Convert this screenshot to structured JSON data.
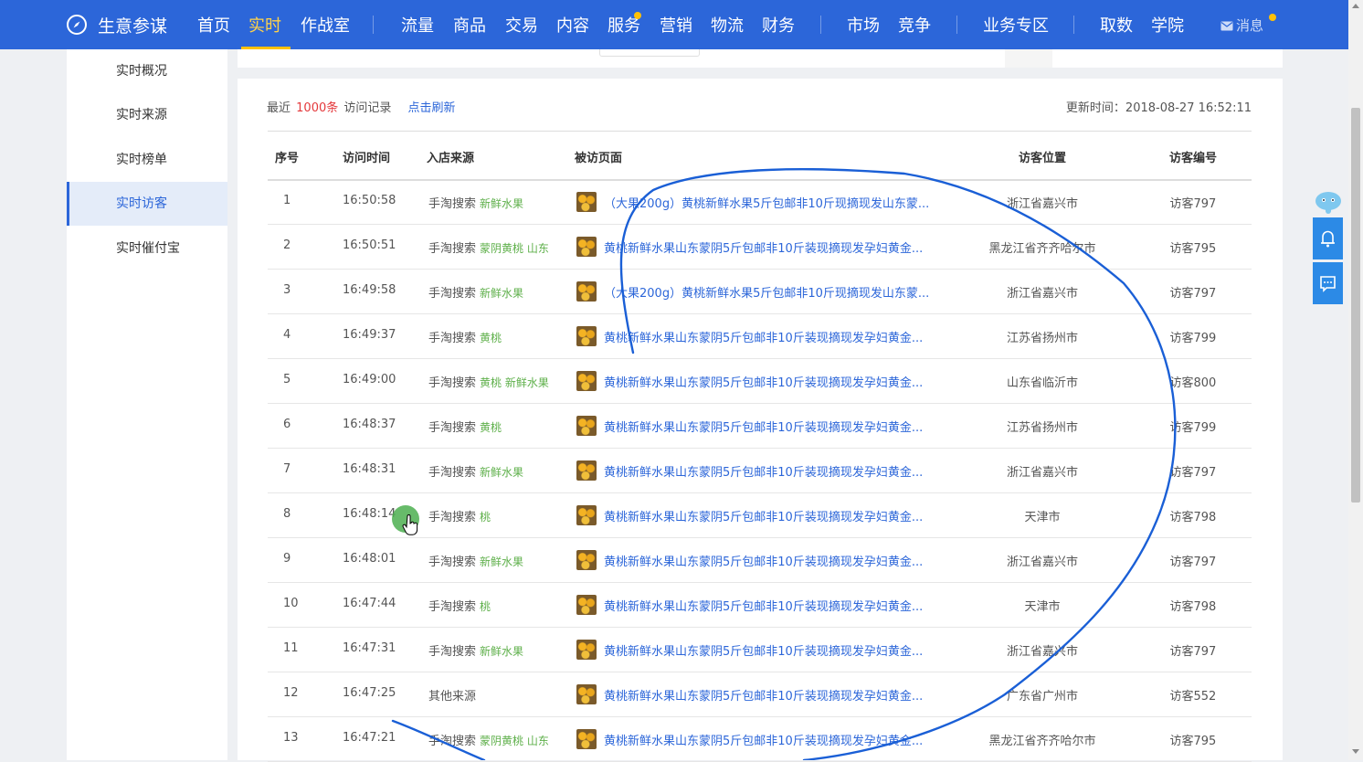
{
  "nav": {
    "brand": "生意参谋",
    "items": [
      "首页",
      "实时",
      "作战室",
      "流量",
      "商品",
      "交易",
      "内容",
      "服务",
      "营销",
      "物流",
      "财务",
      "市场",
      "竞争",
      "业务专区",
      "取数",
      "学院"
    ],
    "active": "实时",
    "message": "消息"
  },
  "sidebar": {
    "items": [
      "实时概况",
      "实时来源",
      "实时榜单",
      "实时访客",
      "实时催付宝"
    ],
    "active": "实时访客"
  },
  "header": {
    "prefix": "最近",
    "count": "1000条",
    "suffix": "访问记录",
    "refresh": "点击刷新",
    "updated": "更新时间：2018-08-27 16:52:11"
  },
  "table": {
    "columns": [
      "序号",
      "访问时间",
      "入店来源",
      "被访页面",
      "访客位置",
      "访客编号"
    ],
    "rows": [
      {
        "no": "1",
        "time": "16:50:58",
        "src": "手淘搜索",
        "kw": "新鲜水果",
        "page": "（大果200g）黄桃新鲜水果5斤包邮非10斤现摘现发山东蒙...",
        "loc": "浙江省嘉兴市",
        "vid": "访客797"
      },
      {
        "no": "2",
        "time": "16:50:51",
        "src": "手淘搜索",
        "kw": "蒙阴黄桃 山东",
        "page": "黄桃新鲜水果山东蒙阴5斤包邮非10斤装现摘现发孕妇黄金...",
        "loc": "黑龙江省齐齐哈尔市",
        "vid": "访客795"
      },
      {
        "no": "3",
        "time": "16:49:58",
        "src": "手淘搜索",
        "kw": "新鲜水果",
        "page": "（大果200g）黄桃新鲜水果5斤包邮非10斤现摘现发山东蒙...",
        "loc": "浙江省嘉兴市",
        "vid": "访客797"
      },
      {
        "no": "4",
        "time": "16:49:37",
        "src": "手淘搜索",
        "kw": "黄桃",
        "page": "黄桃新鲜水果山东蒙阴5斤包邮非10斤装现摘现发孕妇黄金...",
        "loc": "江苏省扬州市",
        "vid": "访客799"
      },
      {
        "no": "5",
        "time": "16:49:00",
        "src": "手淘搜索",
        "kw": "黄桃 新鲜水果",
        "page": "黄桃新鲜水果山东蒙阴5斤包邮非10斤装现摘现发孕妇黄金...",
        "loc": "山东省临沂市",
        "vid": "访客800"
      },
      {
        "no": "6",
        "time": "16:48:37",
        "src": "手淘搜索",
        "kw": "黄桃",
        "page": "黄桃新鲜水果山东蒙阴5斤包邮非10斤装现摘现发孕妇黄金...",
        "loc": "江苏省扬州市",
        "vid": "访客799"
      },
      {
        "no": "7",
        "time": "16:48:31",
        "src": "手淘搜索",
        "kw": "新鲜水果",
        "page": "黄桃新鲜水果山东蒙阴5斤包邮非10斤装现摘现发孕妇黄金...",
        "loc": "浙江省嘉兴市",
        "vid": "访客797"
      },
      {
        "no": "8",
        "time": "16:48:14",
        "src": "手淘搜索",
        "kw": "桃",
        "page": "黄桃新鲜水果山东蒙阴5斤包邮非10斤装现摘现发孕妇黄金...",
        "loc": "天津市",
        "vid": "访客798"
      },
      {
        "no": "9",
        "time": "16:48:01",
        "src": "手淘搜索",
        "kw": "新鲜水果",
        "page": "黄桃新鲜水果山东蒙阴5斤包邮非10斤装现摘现发孕妇黄金...",
        "loc": "浙江省嘉兴市",
        "vid": "访客797"
      },
      {
        "no": "10",
        "time": "16:47:44",
        "src": "手淘搜索",
        "kw": "桃",
        "page": "黄桃新鲜水果山东蒙阴5斤包邮非10斤装现摘现发孕妇黄金...",
        "loc": "天津市",
        "vid": "访客798"
      },
      {
        "no": "11",
        "time": "16:47:31",
        "src": "手淘搜索",
        "kw": "新鲜水果",
        "page": "黄桃新鲜水果山东蒙阴5斤包邮非10斤装现摘现发孕妇黄金...",
        "loc": "浙江省嘉兴市",
        "vid": "访客797"
      },
      {
        "no": "12",
        "time": "16:47:25",
        "src": "其他来源",
        "kw": "",
        "page": "黄桃新鲜水果山东蒙阴5斤包邮非10斤装现摘现发孕妇黄金...",
        "loc": "广东省广州市",
        "vid": "访客552"
      },
      {
        "no": "13",
        "time": "16:47:21",
        "src": "手淘搜索",
        "kw": "蒙阴黄桃 山东",
        "page": "黄桃新鲜水果山东蒙阴5斤包邮非10斤装现摘现发孕妇黄金...",
        "loc": "黑龙江省齐齐哈尔市",
        "vid": "访客795"
      }
    ]
  },
  "colors": {
    "nav_bg": "#2c66d9",
    "active_tab": "#ffd24a",
    "link": "#2c66d9",
    "keyword": "#5fb04b",
    "count": "#e4393c",
    "annotation": "#1a5fd6"
  },
  "icons": {
    "logo": "compass-icon",
    "message": "mail-icon",
    "float1": "bell-icon",
    "float2": "chat-icon",
    "mascot": "elephant-icon"
  }
}
